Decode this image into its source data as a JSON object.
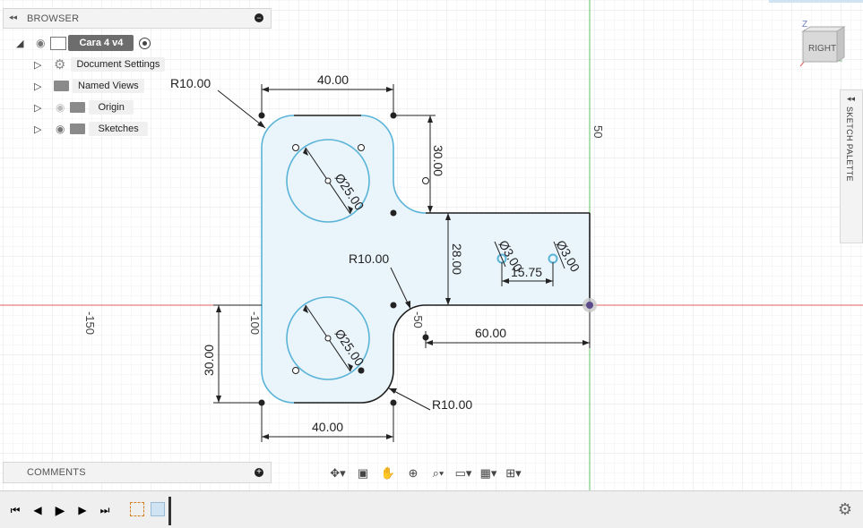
{
  "browser": {
    "title": "BROWSER",
    "root": "Cara 4 v4",
    "items": [
      {
        "label": "Document Settings"
      },
      {
        "label": "Named Views"
      },
      {
        "label": "Origin"
      },
      {
        "label": "Sketches"
      }
    ]
  },
  "comments": {
    "title": "COMMENTS"
  },
  "viewcube": {
    "face": "RIGHT",
    "axis_z": "Z"
  },
  "sketch_palette": {
    "title": "SKETCH PALETTE"
  },
  "grid_labels": {
    "x_neg150": "-150",
    "x_neg100": "-100",
    "x_neg50": "-50",
    "y_50": "50"
  },
  "dimensions": {
    "top_width": "40.00",
    "bottom_width": "40.00",
    "right_height_top": "30.00",
    "left_height_bottom": "30.00",
    "flange_height": "28.00",
    "flange_length": "60.00",
    "hole_spacing": "15.75",
    "radius_top": "R10.00",
    "radius_mid": "R10.00",
    "radius_bottom": "R10.00",
    "dia_top": "Ø25.00",
    "dia_bottom": "Ø25.00",
    "dia_small_left": "Ø3.00",
    "dia_small_right": "Ø3.00"
  },
  "colors": {
    "sketch_blue": "#5ab4d8",
    "profile_fill": "#eaf4fb",
    "x_axis": "#e06060",
    "y_axis": "#60c060",
    "grid_minor": "#eef0f2",
    "grid_major": "#dfe3e7"
  },
  "icons": {
    "eye": "eye-icon",
    "gear": "gear-icon",
    "folder": "folder-icon",
    "settings": "settings-icon"
  }
}
